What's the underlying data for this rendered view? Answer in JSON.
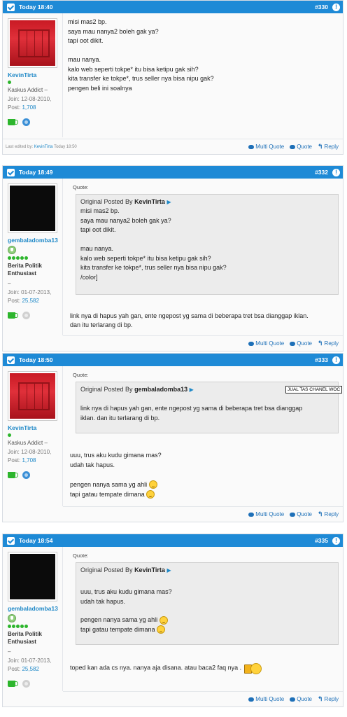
{
  "actions": {
    "multi_quote": "Multi Quote",
    "quote": "Quote",
    "reply": "Reply"
  },
  "quote_label": "Quote:",
  "original_posted_by": "Original Posted By",
  "posts": [
    {
      "time": "Today 18:40",
      "number": "#330",
      "user": {
        "name": "KevinTirta",
        "title": "Kaskus Addict",
        "joined": "Join: 12-08-2010,",
        "posts_label": "Post:",
        "posts": "1,708"
      },
      "message": "misi mas2 bp.\nsaya mau nanya2 boleh gak ya?\ntapi oot dikit.\n\nmau nanya.\nkalo web seperti tokpe* itu bisa ketipu gak sih?\nkita transfer ke tokpe*, trus seller nya bisa nipu gak?\npengen beli ini soalnya",
      "edited_prefix": "Last edited by:",
      "edited_user": "KevinTirta",
      "edited_time": "Today 18:50"
    },
    {
      "time": "Today 18:49",
      "number": "#332",
      "user": {
        "name": "gembaladomba13",
        "title": "Berita Politik Enthusiast",
        "dash": "–",
        "joined": "Join: 01-07-2013,",
        "posts_label": "Post:",
        "posts": "25,582"
      },
      "quote_author": "KevinTirta",
      "quote_text": "misi mas2 bp.\nsaya mau nanya2 boleh gak ya?\ntapi oot dikit.\n\nmau nanya.\nkalo web seperti tokpe* itu bisa ketipu gak sih?\nkita transfer ke tokpe*, trus seller nya bisa nipu gak?\n/color]",
      "message": "link nya di hapus yah gan, ente ngepost yg sama di beberapa tret bsa dianggap iklan.\ndan itu terlarang di bp."
    },
    {
      "time": "Today 18:50",
      "number": "#333",
      "user": {
        "name": "KevinTirta",
        "title": "Kaskus Addict",
        "joined": "Join: 12-08-2010,",
        "posts_label": "Post:",
        "posts": "1,708"
      },
      "quote_author": "gembaladomba13",
      "popup_tag": "JUAL TAS CHANEL WOC",
      "quote_text": "link nya di hapus yah gan, ente ngepost yg sama di beberapa tret bsa dianggap\niklan. dan itu terlarang di bp.",
      "message_lines": [
        "uuu, trus aku kudu gimana mas?",
        "udah tak hapus.",
        "",
        "pengen nanya sama yg ahli",
        "tapi gatau tempate dimana"
      ]
    },
    {
      "time": "Today 18:54",
      "number": "#335",
      "user": {
        "name": "gembaladomba13",
        "title": "Berita Politik Enthusiast",
        "dash": "–",
        "joined": "Join: 01-07-2013,",
        "posts_label": "Post:",
        "posts": "25,582"
      },
      "quote_author": "KevinTirta",
      "quote_lines": [
        "uuu, trus aku kudu gimana mas?",
        "udah tak hapus.",
        "",
        "pengen nanya sama yg ahli",
        "tapi gatau tempate dimana"
      ],
      "message": "toped kan ada cs nya. nanya aja disana. atau baca2 faq nya ."
    }
  ]
}
